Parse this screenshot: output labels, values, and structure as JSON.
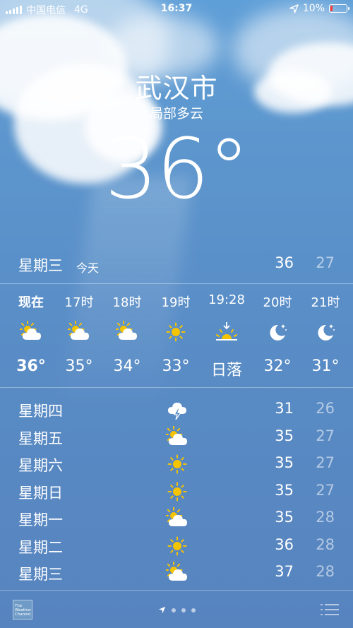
{
  "status_bar": {
    "carrier": "中国电信",
    "network": "4G",
    "time": "16:37",
    "battery": "10%"
  },
  "location": {
    "city": "武汉市",
    "condition": "局部多云",
    "temperature": "36°"
  },
  "today": {
    "day": "星期三",
    "tag": "今天",
    "high": "36",
    "low": "27"
  },
  "hourly": [
    {
      "label": "现在",
      "icon": "partly-cloudy-icon",
      "temp": "36°"
    },
    {
      "label": "17时",
      "icon": "partly-cloudy-icon",
      "temp": "35°"
    },
    {
      "label": "18时",
      "icon": "partly-cloudy-icon",
      "temp": "34°"
    },
    {
      "label": "19时",
      "icon": "sunny-icon",
      "temp": "33°"
    },
    {
      "label": "19:28",
      "icon": "sunset-icon",
      "temp": "日落"
    },
    {
      "label": "20时",
      "icon": "clear-night-icon",
      "temp": "32°"
    },
    {
      "label": "21时",
      "icon": "clear-night-icon",
      "temp": "31°"
    }
  ],
  "daily": [
    {
      "day": "星期四",
      "icon": "thunderstorm-icon",
      "high": "31",
      "low": "26"
    },
    {
      "day": "星期五",
      "icon": "partly-cloudy-icon",
      "high": "35",
      "low": "27"
    },
    {
      "day": "星期六",
      "icon": "sunny-icon",
      "high": "35",
      "low": "27"
    },
    {
      "day": "星期日",
      "icon": "sunny-icon",
      "high": "35",
      "low": "27"
    },
    {
      "day": "星期一",
      "icon": "partly-cloudy-icon",
      "high": "35",
      "low": "28"
    },
    {
      "day": "星期二",
      "icon": "sunny-icon",
      "high": "36",
      "low": "28"
    },
    {
      "day": "星期三",
      "icon": "partly-cloudy-icon",
      "high": "37",
      "low": "28"
    }
  ],
  "footer": {
    "logo": "The Weather Channel",
    "page_count": 3,
    "current_page": 0
  },
  "colors": {
    "sky_top": "#5f9fd8",
    "sky_bottom": "#5784bf",
    "sun": "#f5c400",
    "battery_low": "#ff3b30"
  }
}
